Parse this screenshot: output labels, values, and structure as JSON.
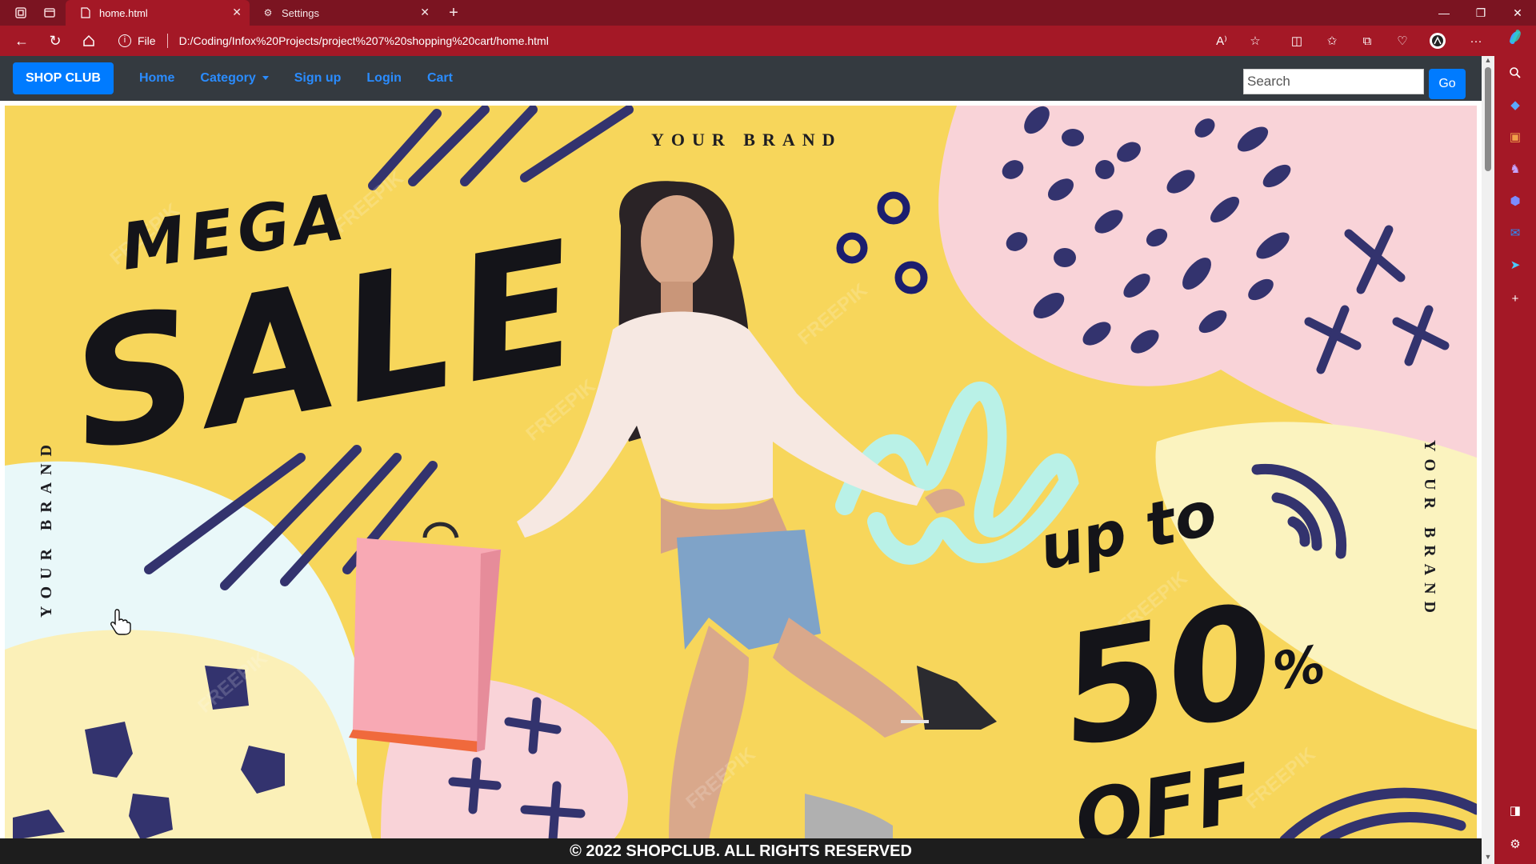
{
  "browser": {
    "tabs": [
      {
        "title": "home.html",
        "active": true
      },
      {
        "title": "Settings",
        "active": false
      }
    ],
    "url_prefix": "File",
    "url": "D:/Coding/Infox%20Projects/project%207%20shopping%20cart/home.html",
    "accent_color": "#a41826"
  },
  "navbar": {
    "brand": "SHOP CLUB",
    "links": [
      "Home",
      "Category",
      "Sign up",
      "Login",
      "Cart"
    ],
    "search_placeholder": "Search",
    "go_label": "Go"
  },
  "banner": {
    "headline_top": "MEGA",
    "headline_main": "SALE",
    "brand_text": "YOUR BRAND",
    "discount_prefix": "up to",
    "discount_value": "50",
    "discount_unit": "%",
    "discount_suffix": "OFF",
    "watermark": "FREEPIK"
  },
  "footer": {
    "text": "© 2022 SHOPCLUB. ALL RIGHTS RESERVED"
  }
}
